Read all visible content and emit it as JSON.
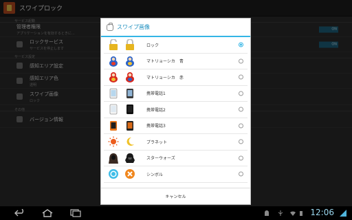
{
  "app": {
    "title": "スワイプロック",
    "sections": [
      {
        "header": "サービス起動",
        "rows": [
          {
            "title": "管理者権限",
            "subtitle": "アプリケーションを有効するときに...",
            "switch": "ON"
          },
          {
            "title": "ロックサービス",
            "subtitle": "サービスを停止します",
            "switch": "ON"
          }
        ]
      },
      {
        "header": "サービス設定",
        "rows": [
          {
            "title": "感知エリア設定",
            "subtitle": ""
          },
          {
            "title": "感知エリア色",
            "subtitle": "透明"
          },
          {
            "title": "スワイプ画像",
            "subtitle": "ロック"
          }
        ]
      },
      {
        "header": "その他",
        "rows": [
          {
            "title": "バージョン情報",
            "subtitle": ""
          }
        ]
      }
    ]
  },
  "dialog": {
    "title": "スワイプ画像",
    "items": [
      {
        "label": "ロック",
        "selected": true,
        "icons": [
          "lock-open-icon",
          "lock-closed-icon"
        ]
      },
      {
        "label": "マトリョーシカ　青",
        "selected": false,
        "icons": [
          "matryoshka-blue-icon",
          "matryoshka-blue-icon"
        ]
      },
      {
        "label": "マトリョーシカ　赤",
        "selected": false,
        "icons": [
          "matryoshka-red-icon",
          "matryoshka-red-icon"
        ]
      },
      {
        "label": "携帯電話1",
        "selected": false,
        "icons": [
          "phone-white-icon",
          "phone-dark-icon"
        ]
      },
      {
        "label": "携帯電話2",
        "selected": false,
        "icons": [
          "phone-white-icon",
          "phone-black-icon"
        ]
      },
      {
        "label": "携帯電話3",
        "selected": false,
        "icons": [
          "phone-orange-icon",
          "phone-black-icon"
        ]
      },
      {
        "label": "プラネット",
        "selected": false,
        "icons": [
          "sun-icon",
          "moon-icon"
        ]
      },
      {
        "label": "スターウォーズ",
        "selected": false,
        "icons": [
          "hooded-figure-icon",
          "dark-helmet-icon"
        ]
      },
      {
        "label": "シンボル",
        "selected": false,
        "icons": [
          "circle-symbol-icon",
          "cross-symbol-icon"
        ]
      }
    ],
    "cancel_label": "キャンセル"
  },
  "navbar": {
    "clock": "12:06"
  },
  "colors": {
    "accent": "#33b5e5",
    "title": "#1e8fbf"
  }
}
